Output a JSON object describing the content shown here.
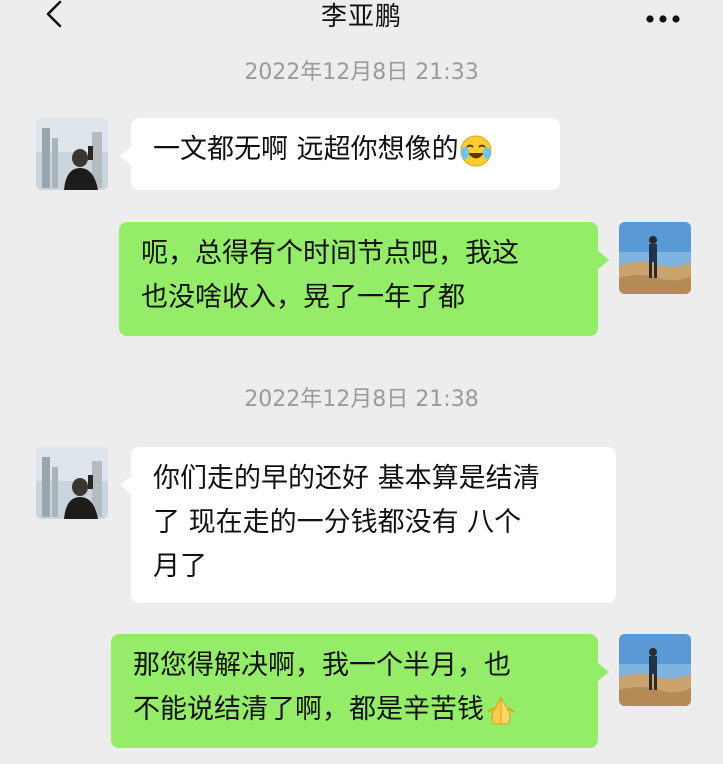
{
  "header": {
    "title": "李亚鹏"
  },
  "timestamps": [
    "2022年12月8日 21:33",
    "2022年12月8日 21:38"
  ],
  "messages": [
    {
      "side": "left",
      "text": "一文都无啊 远超你想像的",
      "emoji": "laughing-crying-emoji"
    },
    {
      "side": "right",
      "line1": "呃，总得有个时间节点吧，我这",
      "line2": "也没啥收入，晃了一年了都"
    },
    {
      "side": "left",
      "line1": "你们走的早的还好 基本算是结清",
      "line2": "了 现在走的一分钱都没有 八个",
      "line3": "月了"
    },
    {
      "side": "right",
      "line1": "那您得解决啊，我一个半月，也",
      "line2": "不能说结清了啊，都是辛苦钱",
      "emoji": "praying-hands-emoji"
    }
  ],
  "colors": {
    "background": "#ededed",
    "bubble_left": "#ffffff",
    "bubble_right": "#95ec69"
  }
}
